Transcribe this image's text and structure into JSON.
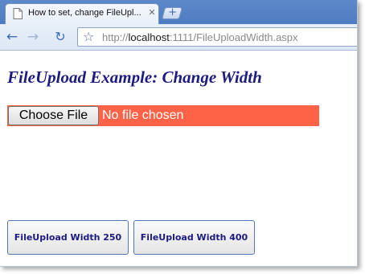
{
  "browser": {
    "tab": {
      "title": "How to set, change FileUpl...",
      "close_glyph": "✕",
      "favicon": "page-icon"
    },
    "new_tab_glyph": "+",
    "toolbar": {
      "back_glyph": "←",
      "forward_glyph": "→",
      "reload_glyph": "↻",
      "star_glyph": "☆"
    },
    "url": {
      "scheme": "http://",
      "host": "localhost",
      "rest": ":1111/FileUploadWidth.aspx"
    }
  },
  "page": {
    "heading": "FileUpload Example: Change Width",
    "file_upload": {
      "button_label": "Choose File",
      "status_text": "No file chosen",
      "background_color": "#ff6347"
    },
    "buttons": {
      "width_250_label": "FileUpload Width 250",
      "width_400_label": "FileUpload Width 400"
    }
  },
  "colors": {
    "heading": "#1c1c80",
    "tabstrip": "#4f7cc2",
    "button_border": "#4f77b3"
  }
}
